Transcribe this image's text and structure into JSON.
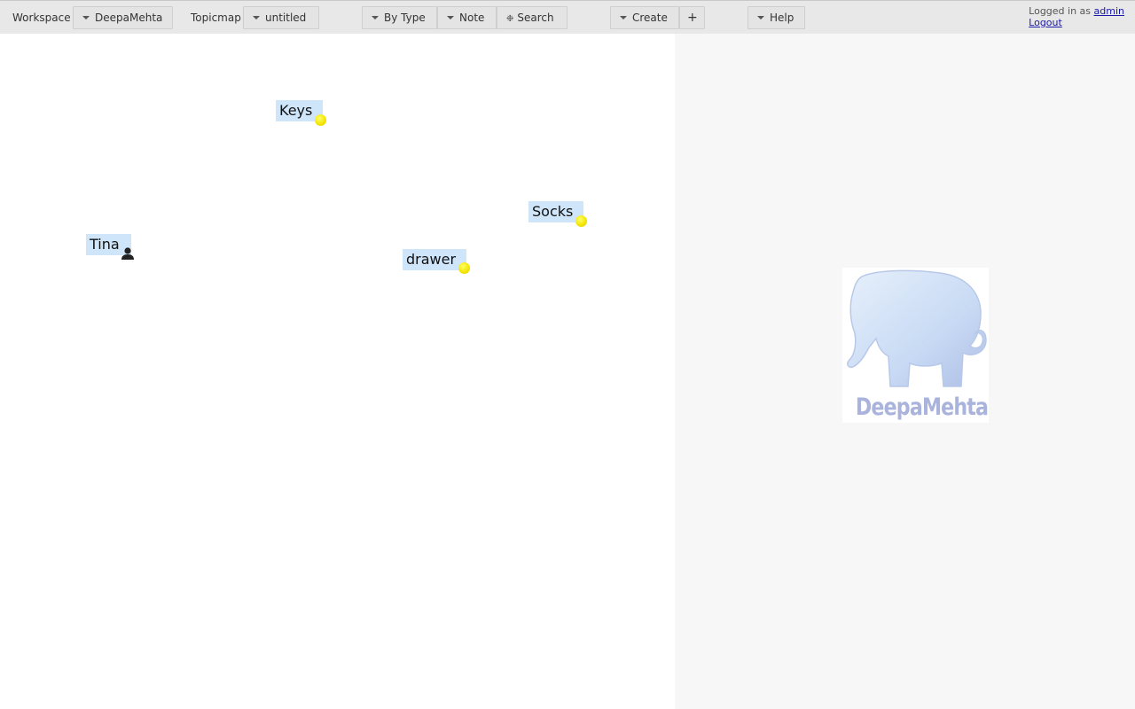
{
  "toolbar": {
    "workspace_label": "Workspace",
    "workspace_value": "DeepaMehta",
    "topicmap_label": "Topicmap",
    "topicmap_value": "untitled",
    "by_type_label": "By Type",
    "note_label": "Note",
    "search_label": "Search",
    "create_label": "Create",
    "add_label": "+",
    "help_label": "Help"
  },
  "login": {
    "prefix": "Logged in as",
    "username": "admin",
    "logout": "Logout"
  },
  "topics": [
    {
      "label": "Keys",
      "icon": "yellow-dot-icon"
    },
    {
      "label": "Socks",
      "icon": "yellow-dot-icon"
    },
    {
      "label": "Tina",
      "icon": "person-icon"
    },
    {
      "label": "drawer",
      "icon": "yellow-dot-icon"
    }
  ],
  "detail_panel": {
    "logo_text": "DeepaMehta"
  },
  "colors": {
    "topic_highlight": "#cfe5fa",
    "topic_dot": "#f2e400",
    "logo_tint": "#a9b3dc"
  }
}
